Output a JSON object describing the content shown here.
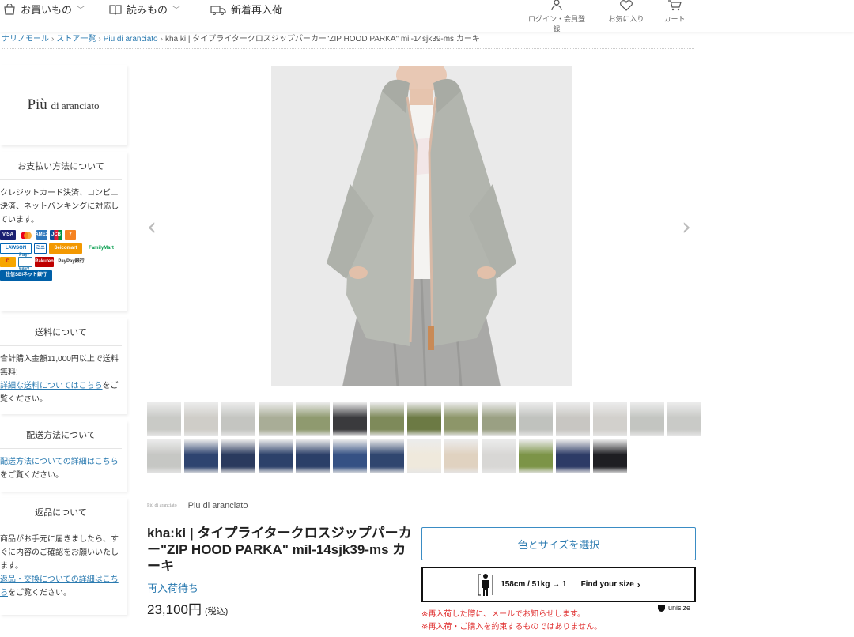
{
  "header": {
    "nav": [
      {
        "label": "お買いもの"
      },
      {
        "label": "読みもの"
      },
      {
        "label": "新着再入荷"
      }
    ],
    "icons": [
      {
        "label": "ログイン・会員登録"
      },
      {
        "label": "お気に入り"
      },
      {
        "label": "カート"
      }
    ]
  },
  "breadcrumb": {
    "items": [
      "ナリノモール",
      "ストア一覧",
      "Piu di aranciato"
    ],
    "current": "kha:ki | タイプライタークロスジップパーカー\"ZIP HOOD PARKA\" mil-14sjk39-ms カーキ"
  },
  "sidebar": {
    "logo_main": "Più",
    "logo_sub": "di aranciato",
    "payment": {
      "title": "お支払い方法について",
      "text": "クレジットカード決済、コンビニ決済、ネットバンキングに対応しています。",
      "logos_row1": [
        "VISA",
        "MC",
        "AMEX",
        "JCB",
        "7"
      ],
      "logos_row2": [
        "LAWSON",
        "ミニ",
        "Seicomart",
        "FamilyMart"
      ],
      "logos_row3": [
        "D",
        "Pay-easy",
        "Rakuten",
        "PayPay銀行"
      ],
      "logos_row4": [
        "住信SBIネット銀行"
      ]
    },
    "shipping": {
      "title": "送料について",
      "text1": "合計購入金額11,000円以上で送料無料!",
      "link": "詳細な送料についてはこちら",
      "text2": "をご覧ください。"
    },
    "delivery": {
      "title": "配送方法について",
      "link": "配送方法についての詳細はこちら",
      "text2": "をご覧ください。"
    },
    "returns": {
      "title": "返品について",
      "text1": "商品がお手元に届きましたら、すぐに内容のご確認をお願いいたします。",
      "link": "返品・交換についての詳細はこちら",
      "text2": "をご覧ください。"
    }
  },
  "gallery": {
    "prev_icon": "chevron-left-icon",
    "next_icon": "chevron-right-icon",
    "thumbs_row1": [
      "#c9cac6",
      "#cfcdc8",
      "#c4c5c1",
      "#a9ad97",
      "#8f9a6f",
      "#3a3a3d",
      "#7e8a5a",
      "#6c7a44",
      "#8d9669",
      "#9aa083",
      "#c0c2be",
      "#c8c6c2",
      "#d2d0cc",
      "#c3c5c1",
      "#c9cac7"
    ],
    "thumbs_row2": [
      "#c6c7c4",
      "#2e4470",
      "#2a3a5e",
      "#2c416a",
      "#2b3f68",
      "#355184",
      "#30466f",
      "#efe9dc",
      "#e0d2c0",
      "#d8d7d5",
      "#7c9447",
      "#2d3b66",
      "#1e1e22"
    ]
  },
  "product": {
    "brand_mini": "Più di aranciato",
    "brand": "Piu di aranciato",
    "title": "kha:ki | タイプライタークロスジップパーカー\"ZIP HOOD PARKA\" mil-14sjk39-ms カーキ",
    "restock": "再入荷待ち",
    "price": "23,100円",
    "tax": "(税込)",
    "select_button": "色とサイズを選択",
    "size_info": "158cm / 51kg → 1",
    "find_size": "Find your size",
    "unisize": "unisize",
    "notice1": "※再入荷した際に、メールでお知らせします。",
    "notice2": "※再入荷・ご購入を約束するものではありません。"
  }
}
